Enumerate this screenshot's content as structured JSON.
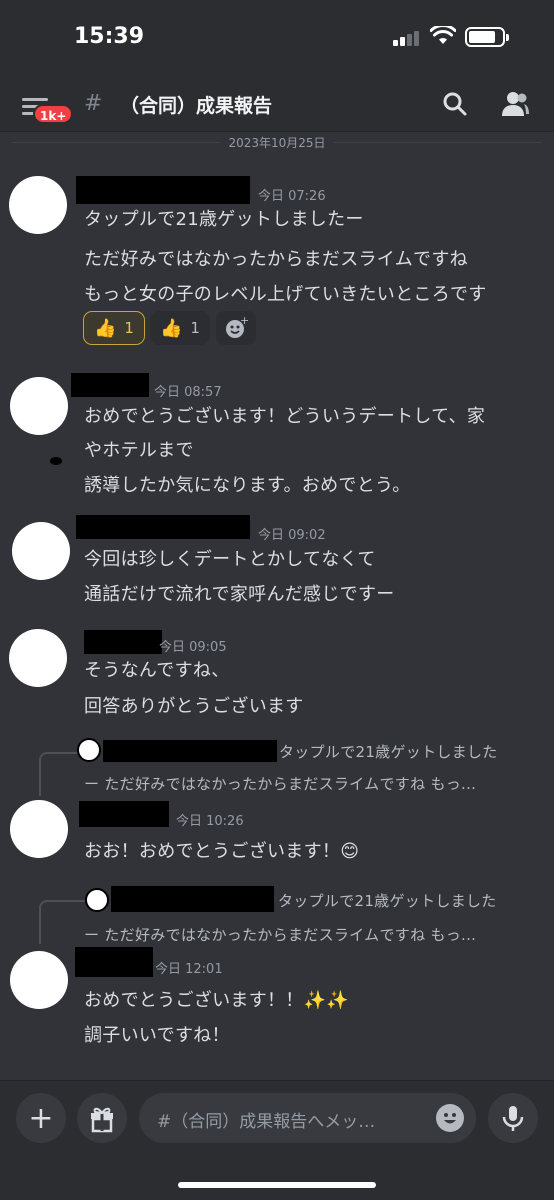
{
  "status": {
    "time": "15:39"
  },
  "header": {
    "badge": "1k+",
    "channel_name": "（合同）成果報告"
  },
  "date_divider": "2023年10月25日",
  "messages": [
    {
      "time": "今日 07:26",
      "lines": [
        "タップルで21歳ゲットしましたー",
        "ただ好みではなかったからまだスライムですね",
        "もっと女の子のレベル上げていきたいところです"
      ],
      "reactions": [
        {
          "emoji": "👍",
          "count": "1",
          "active": true
        },
        {
          "emoji": "👍",
          "count": "1",
          "active": false
        }
      ]
    },
    {
      "time": "今日 08:57",
      "lines": [
        "おめでとうございます！どういうデートして、家",
        "やホテルまで",
        "誘導したか気になります。おめでとう。"
      ]
    },
    {
      "time": "今日 09:02",
      "lines": [
        "今回は珍しくデートとかしてなくて",
        "通話だけで流れで家呼んだ感じですー"
      ]
    },
    {
      "time": "今日 09:05",
      "lines": [
        "そうなんですね、",
        "回答ありがとうございます"
      ]
    },
    {
      "reply": [
        "タップルで21歳ゲットしました",
        "ー ただ好みではなかったからまだスライムですね もっ..."
      ],
      "time": "今日 10:26",
      "lines": [
        "おお！おめでとうございます！😊"
      ]
    },
    {
      "reply": [
        "タップルで21歳ゲットしました",
        "ー ただ好みではなかったからまだスライムですね もっ..."
      ],
      "time": "今日 12:01",
      "lines": [
        "おめでとうございます！！✨✨",
        "調子いいですね！"
      ]
    }
  ],
  "composer": {
    "placeholder": "#（合同）成果報告へメッ…"
  },
  "icons": {
    "plus": "plus-icon",
    "gift": "gift-icon",
    "emoji": "emoji-icon",
    "mic": "microphone-icon",
    "search": "search-icon",
    "members": "members-icon"
  }
}
